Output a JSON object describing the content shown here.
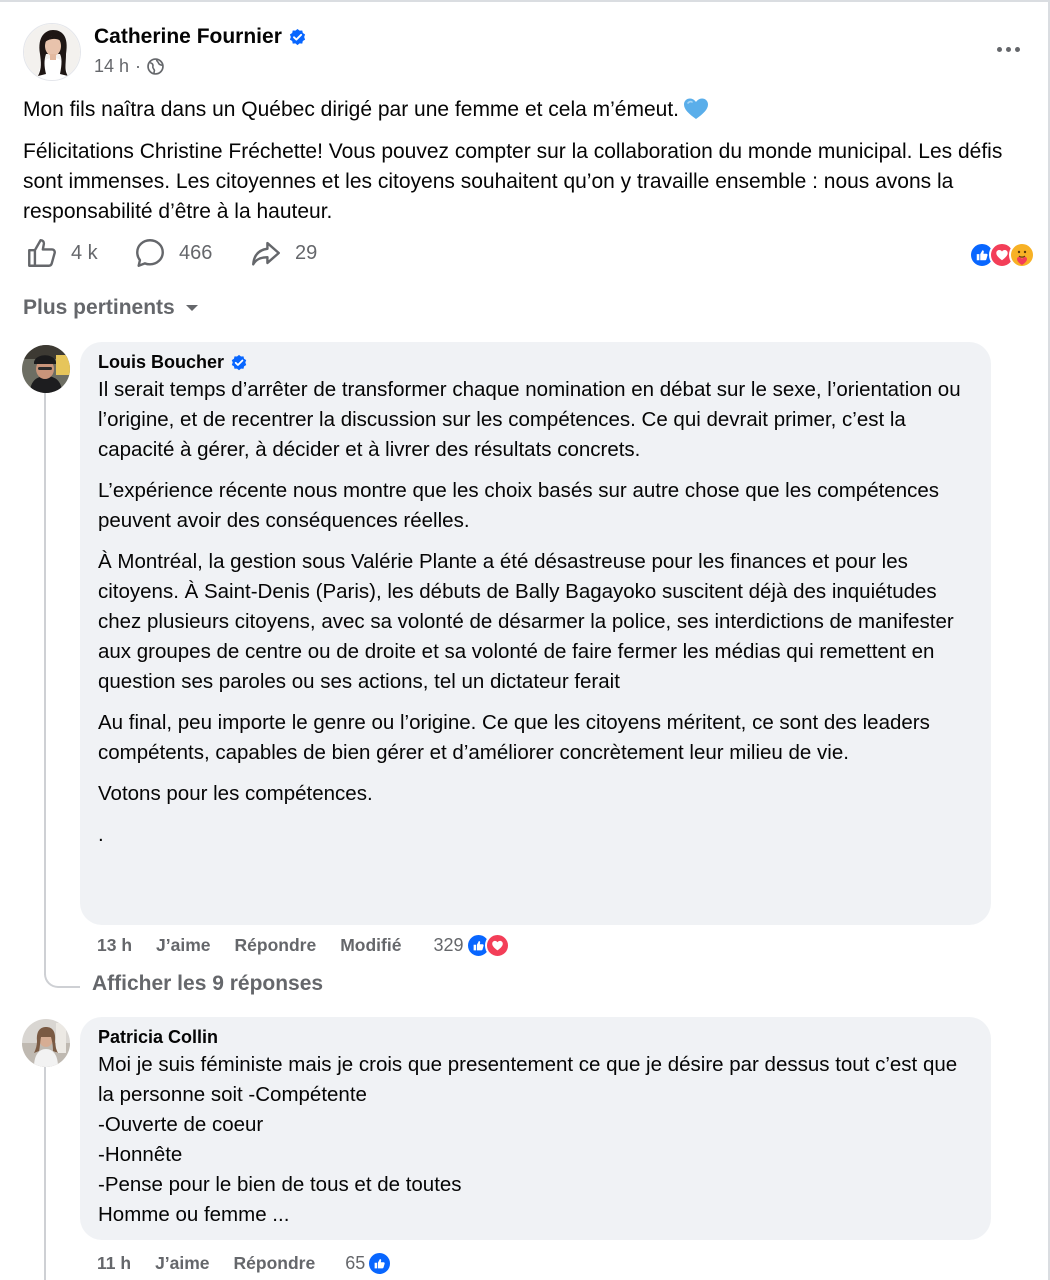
{
  "post": {
    "author": "Catherine Fournier",
    "time": "14 h",
    "separator": "·",
    "paragraph_1": "Mon fils naîtra dans un Québec dirigé par une femme et cela m’émeut.",
    "paragraph_2": "Félicitations Christine Fréchette! Vous pouvez compter sur la collaboration du monde municipal. Les défis sont immenses. Les citoyennes et les citoyens souhaitent qu’on y travaille ensemble : nous avons la responsabilité d’être à la hauteur.",
    "likes": "4 k",
    "comments": "466",
    "shares": "29"
  },
  "sort_label": "Plus pertinents",
  "comments": [
    {
      "author": "Louis Boucher",
      "verified": true,
      "paragraphs": [
        "Il serait temps d’arrêter de transformer chaque nomination en débat sur le sexe, l’orientation ou l’origine, et de recentrer la discussion sur les compétences. Ce qui devrait primer, c’est la capacité à gérer, à décider et à livrer des résultats concrets.",
        "L’expérience récente nous montre que les choix basés sur autre chose que les compétences peuvent avoir des conséquences réelles.",
        "À Montréal, la gestion sous Valérie Plante a été désastreuse pour les finances et pour les citoyens. À Saint-Denis (Paris), les débuts de Bally Bagayoko suscitent déjà des inquiétudes chez plusieurs citoyens, avec sa volonté de désarmer la police, ses interdictions de manifester aux groupes de centre ou de droite et sa volonté de faire fermer les médias qui remettent en question ses paroles ou ses actions, tel un dictateur ferait",
        "Au final, peu importe le genre ou l’origine. Ce que les citoyens méritent, ce sont des leaders compétents, capables de bien gérer et d’améliorer concrètement leur milieu de vie.",
        "Votons pour les compétences.",
        "."
      ],
      "time": "13 h",
      "like_label": "J’aime",
      "reply_label": "Répondre",
      "edited_label": "Modifié",
      "reaction_count": "329"
    },
    {
      "author": "Patricia Collin",
      "verified": false,
      "lines": [
        "Moi je suis féministe mais je crois que presentement ce que je désire par dessus tout c’est que la personne soit -Compétente",
        "-Ouverte de coeur",
        "-Honnête",
        "-Pense pour le bien de tous et de toutes",
        "Homme ou femme ..."
      ],
      "time": "11 h",
      "like_label": "J’aime",
      "reply_label": "Répondre",
      "reaction_count": "65"
    }
  ],
  "show_replies": "Afficher les 9 réponses",
  "colors": {
    "like_blue": "#0866ff",
    "love_red": "#f33e58",
    "care_yellow": "#f7b125",
    "secondary_text": "#65676b",
    "bubble_bg": "#f0f2f5"
  },
  "icons": [
    "verified-badge-icon",
    "globe-icon",
    "more-icon",
    "like-icon",
    "comment-icon",
    "share-icon",
    "like-reaction-icon",
    "love-reaction-icon",
    "care-reaction-icon",
    "blue-heart-icon",
    "caret-down-icon"
  ]
}
